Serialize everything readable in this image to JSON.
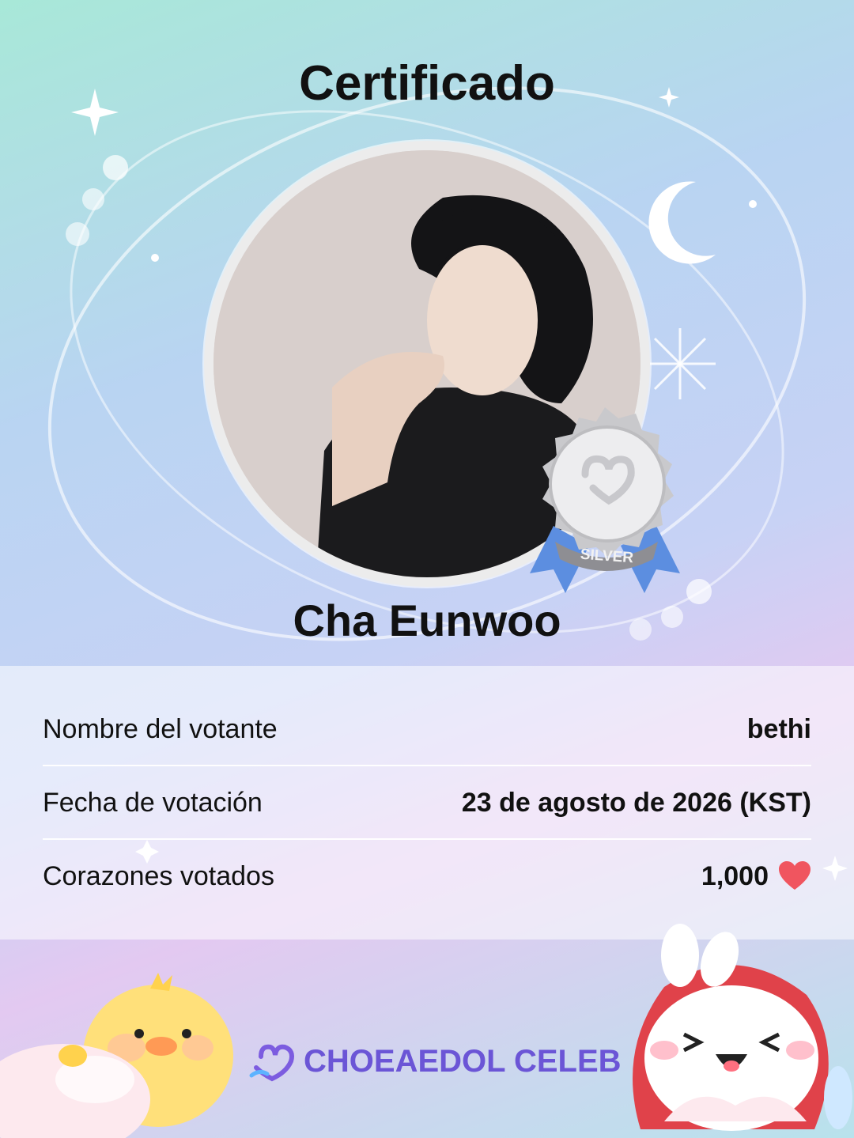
{
  "header": {
    "title": "Certificado"
  },
  "celeb": {
    "name": "Cha Eunwoo",
    "badge_label": "SILVER"
  },
  "info": {
    "rows": [
      {
        "label": "Nombre del votante",
        "value": "bethi"
      },
      {
        "label": "Fecha de votación",
        "value": "23 de agosto de 2026 (KST)"
      },
      {
        "label": "Corazones votados",
        "value": "1,000"
      }
    ]
  },
  "footer": {
    "brand": "CHOEAEDOL CELEB"
  },
  "colors": {
    "brand": "#6b55d6",
    "heart": "#f0555f",
    "badge_silver": "#d6d6d6",
    "ribbon": "#5c8ee0"
  }
}
